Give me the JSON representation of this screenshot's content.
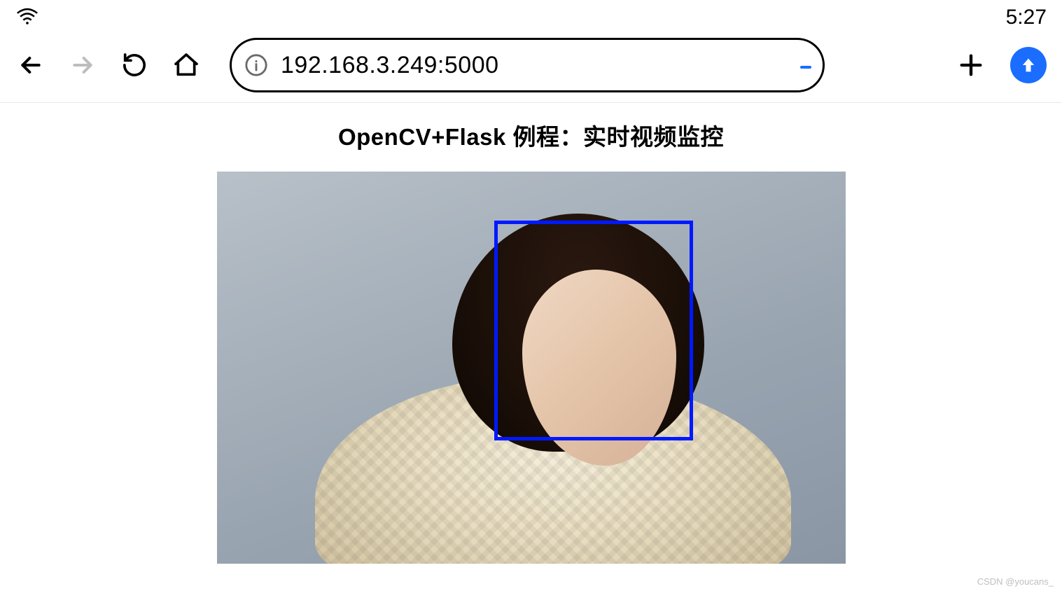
{
  "statusbar": {
    "time": "5:27"
  },
  "browser": {
    "url": "192.168.3.249:5000"
  },
  "page": {
    "title": "OpenCV+Flask 例程：实时视频监控"
  },
  "watermark": "CSDN @youcans_"
}
